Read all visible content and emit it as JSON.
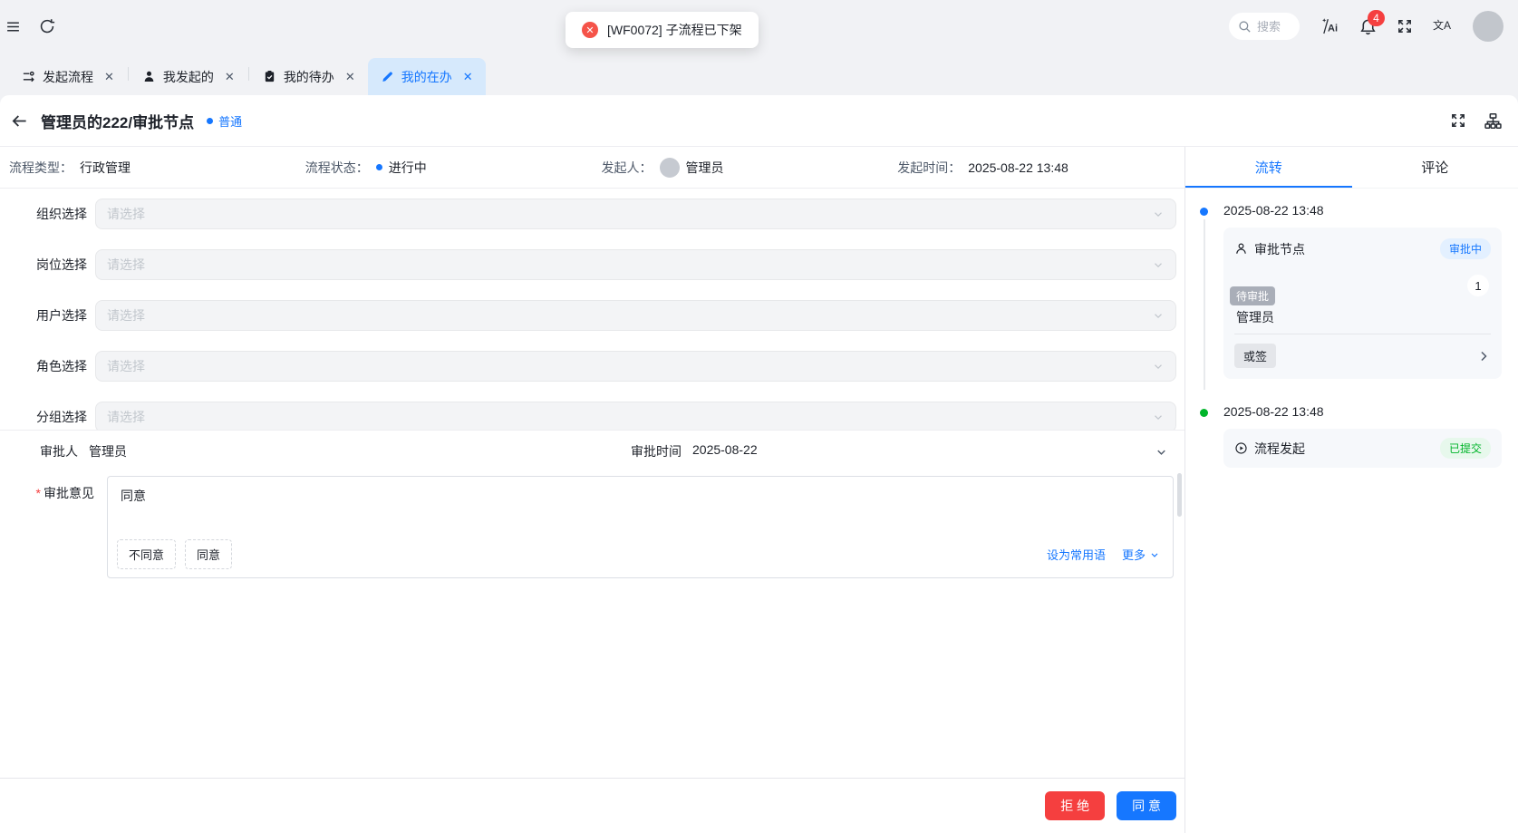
{
  "colors": {
    "accent": "#1677ff",
    "danger": "#f53f3f",
    "success": "#00b42a"
  },
  "icons": {
    "close": "✕"
  },
  "topbar": {
    "search_placeholder": "搜索",
    "notification_count": "4",
    "ai_glyph": "Ai",
    "translate_glyph": "文A"
  },
  "toast": {
    "message": "[WF0072] 子流程已下架"
  },
  "tabs": [
    {
      "label": "发起流程"
    },
    {
      "label": "我发起的"
    },
    {
      "label": "我的待办"
    },
    {
      "label": "我的在办"
    }
  ],
  "page": {
    "title": "管理员的222/审批节点",
    "priority": "普通"
  },
  "meta": {
    "type_label": "流程类型：",
    "type_value": "行政管理",
    "status_label": "流程状态：",
    "status_value": "进行中",
    "initiator_label": "发起人：",
    "initiator_value": "管理员",
    "time_label": "发起时间：",
    "time_value": "2025-08-22 13:48"
  },
  "form": {
    "placeholder": "请选择",
    "fields": [
      {
        "label": "组织选择"
      },
      {
        "label": "岗位选择"
      },
      {
        "label": "用户选择"
      },
      {
        "label": "角色选择"
      },
      {
        "label": "分组选择"
      }
    ]
  },
  "approval": {
    "approver_label": "审批人",
    "approver_value": "管理员",
    "time_label": "审批时间",
    "time_value": "2025-08-22",
    "opinion_label": "审批意见",
    "opinion_value": "同意",
    "quick_replies": [
      {
        "label": "不同意"
      },
      {
        "label": "同意"
      }
    ],
    "set_common": "设为常用语",
    "more": "更多",
    "reject": "拒 绝",
    "approve": "同 意"
  },
  "panel": {
    "tabs": [
      {
        "label": "流转"
      },
      {
        "label": "评论"
      }
    ],
    "timeline": [
      {
        "time": "2025-08-22 13:48",
        "title": "审批节点",
        "status": "审批中",
        "avatar_tag": "待审批",
        "person": "管理员",
        "count": "1",
        "sign_mode": "或签"
      },
      {
        "time": "2025-08-22 13:48",
        "title": "流程发起",
        "status": "已提交"
      }
    ]
  }
}
